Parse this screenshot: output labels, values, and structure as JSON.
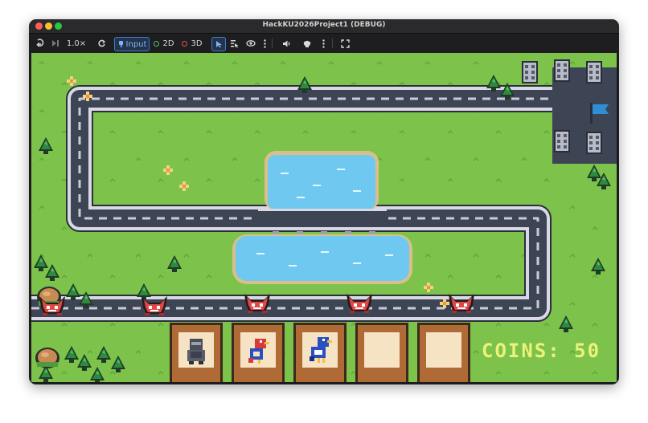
{
  "window": {
    "title": "HackKU2026Project1 (DEBUG)"
  },
  "toolbar": {
    "speed": "1.0×",
    "input_label": "Input",
    "mode_2d": "2D",
    "mode_3d": "3D"
  },
  "game": {
    "coins_label": "COINS:",
    "coins_value": "50",
    "slots": [
      {
        "content": "knight-unit"
      },
      {
        "content": "red-bird-unit"
      },
      {
        "content": "blue-bird-unit"
      },
      {
        "content": "empty"
      },
      {
        "content": "empty"
      }
    ],
    "enemies": [
      "red-horned-enemy",
      "red-horned-enemy",
      "red-horned-enemy",
      "red-horned-enemy",
      "red-horned-enemy"
    ]
  },
  "colors": {
    "grass": "#7cc24b",
    "road": "#3d4555",
    "road_edge": "#d9d9e6",
    "water": "#6ec8f0",
    "slot_frame": "#b06a35",
    "coins_text": "#ecf27a",
    "enemy": "#e04848"
  }
}
